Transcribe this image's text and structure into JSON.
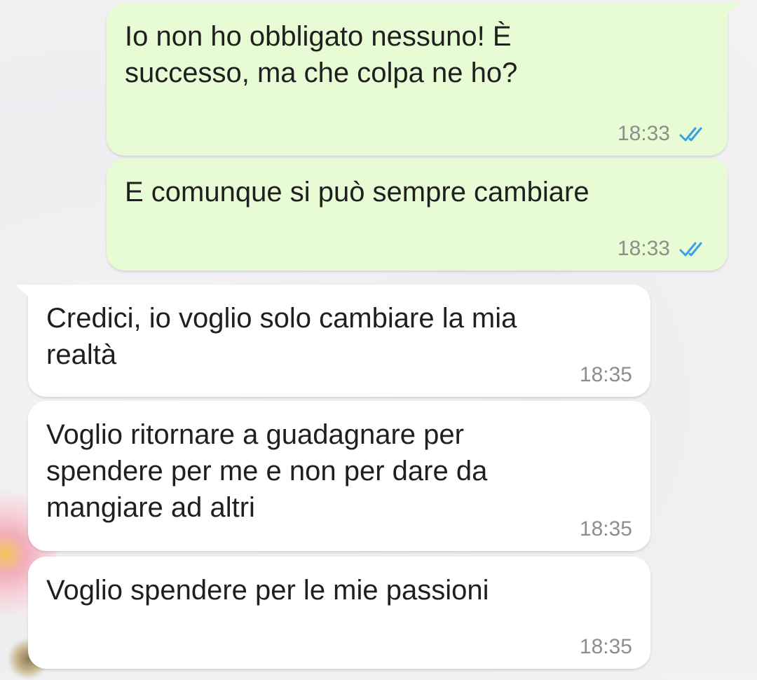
{
  "messages": [
    {
      "direction": "outgoing",
      "text_lines": [
        "Io non ho obbligato nessuno! È",
        "successo, ma che colpa ne ho?"
      ],
      "time": "18:33",
      "status": "read",
      "status_icon": "double-check-icon"
    },
    {
      "direction": "outgoing",
      "text_lines": [
        "E comunque si può sempre cambiare"
      ],
      "time": "18:33",
      "status": "read",
      "status_icon": "double-check-icon"
    },
    {
      "direction": "incoming",
      "text_lines": [
        "Credici, io voglio solo cambiare la mia",
        "realtà"
      ],
      "time": "18:35"
    },
    {
      "direction": "incoming",
      "text_lines": [
        "Voglio ritornare a guadagnare per",
        "spendere per me e non per dare da",
        "mangiare ad altri"
      ],
      "time": "18:35"
    },
    {
      "direction": "incoming",
      "text_lines": [
        "Voglio spendere per le mie passioni"
      ],
      "time": "18:35"
    }
  ],
  "colors": {
    "outgoing_bubble": "#e7fcd4",
    "incoming_bubble": "#ffffff",
    "read_ticks": "#3aa0e6",
    "timestamp": "#8b8f8a"
  }
}
